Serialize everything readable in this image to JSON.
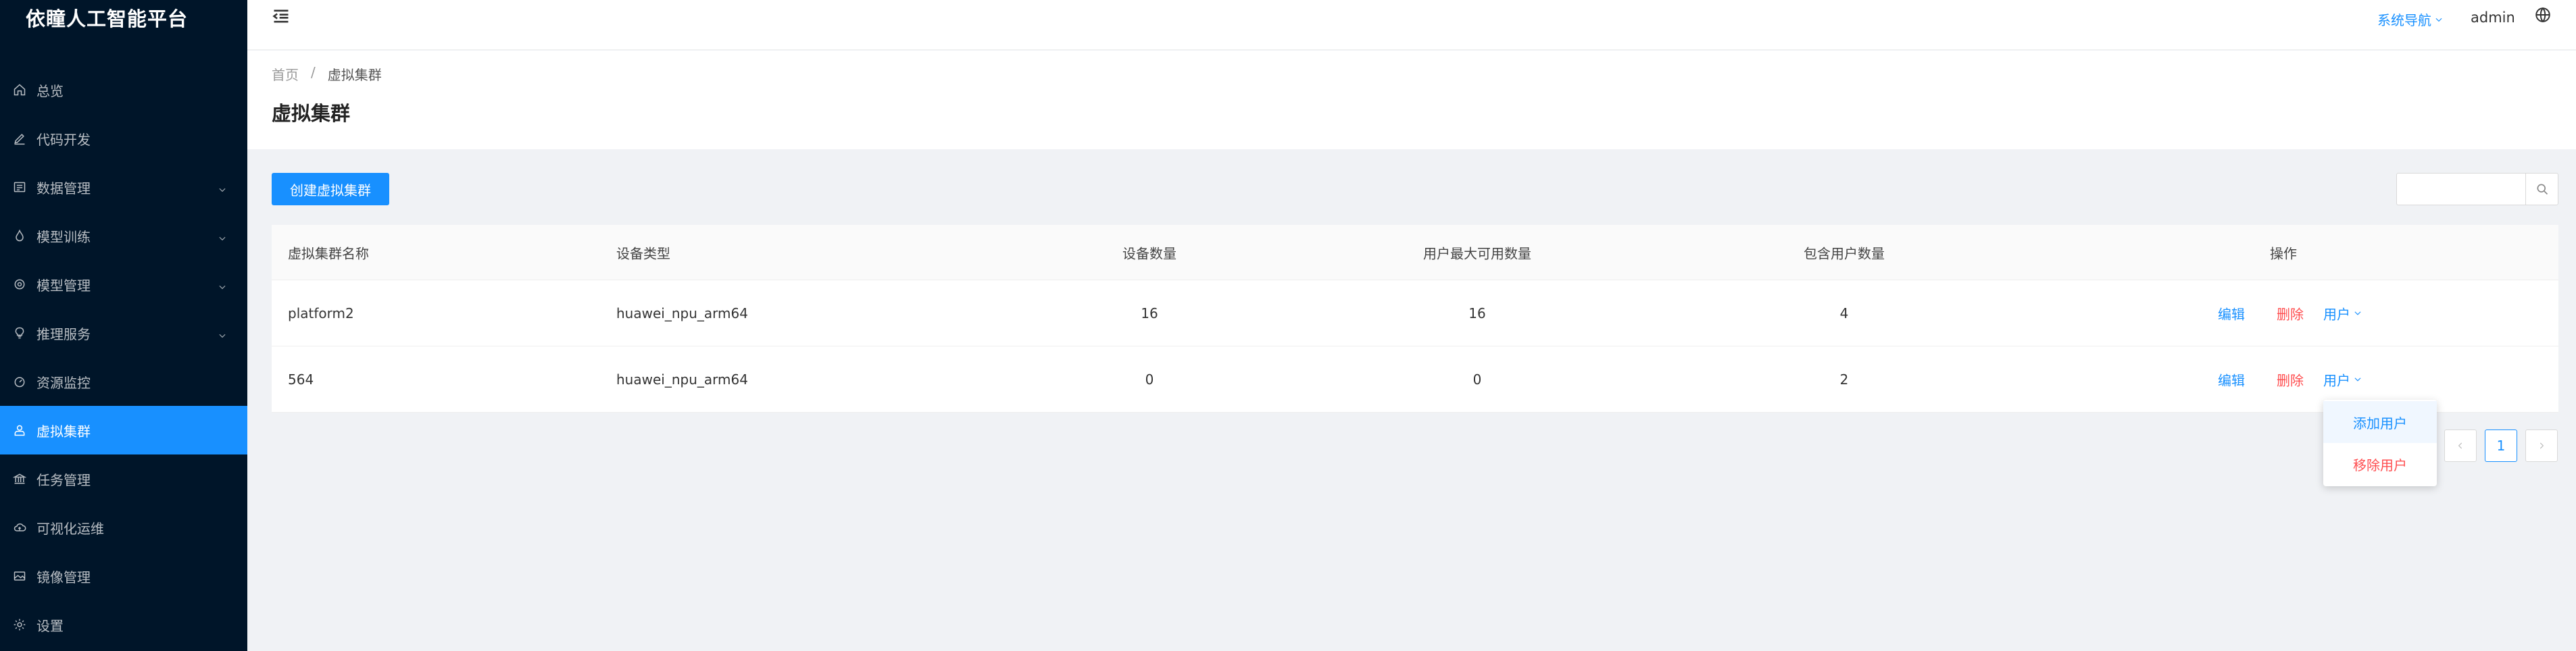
{
  "app": {
    "title": "依瞳人工智能平台"
  },
  "sidebar": {
    "items": [
      {
        "label": "总览",
        "icon": "home-icon"
      },
      {
        "label": "代码开发",
        "icon": "edit-icon"
      },
      {
        "label": "数据管理",
        "icon": "dataset-icon",
        "expandable": true
      },
      {
        "label": "模型训练",
        "icon": "flame-icon",
        "expandable": true
      },
      {
        "label": "模型管理",
        "icon": "model-icon",
        "expandable": true
      },
      {
        "label": "推理服务",
        "icon": "bulb-icon",
        "expandable": true
      },
      {
        "label": "资源监控",
        "icon": "dashboard-icon"
      },
      {
        "label": "虚拟集群",
        "icon": "cluster-icon",
        "active": true
      },
      {
        "label": "任务管理",
        "icon": "bank-icon"
      },
      {
        "label": "可视化运维",
        "icon": "cloud-icon"
      },
      {
        "label": "镜像管理",
        "icon": "image-icon"
      },
      {
        "label": "设置",
        "icon": "gear-icon"
      }
    ]
  },
  "header": {
    "system_nav": "系统导航",
    "user": "admin"
  },
  "breadcrumb": {
    "home": "首页",
    "separator": "/",
    "current": "虚拟集群"
  },
  "page": {
    "title": "虚拟集群"
  },
  "toolbar": {
    "create_label": "创建虚拟集群",
    "search_value": ""
  },
  "table": {
    "columns": [
      "虚拟集群名称",
      "设备类型",
      "设备数量",
      "用户最大可用数量",
      "包含用户数量",
      "操作"
    ],
    "rows": [
      {
        "name": "platform2",
        "device_type": "huawei_npu_arm64",
        "device_count": "16",
        "max_users": "16",
        "user_count": "4"
      },
      {
        "name": "564",
        "device_type": "huawei_npu_arm64",
        "device_count": "0",
        "max_users": "0",
        "user_count": "2"
      }
    ],
    "actions": {
      "edit": "编辑",
      "delete": "删除",
      "user": "用户"
    }
  },
  "pagination": {
    "current_page": "1"
  },
  "dropdown": {
    "items": [
      "添加用户",
      "移除用户"
    ]
  },
  "colors": {
    "primary": "#1890ff",
    "danger": "#ff4d4f",
    "sidebar_bg": "#001529"
  }
}
